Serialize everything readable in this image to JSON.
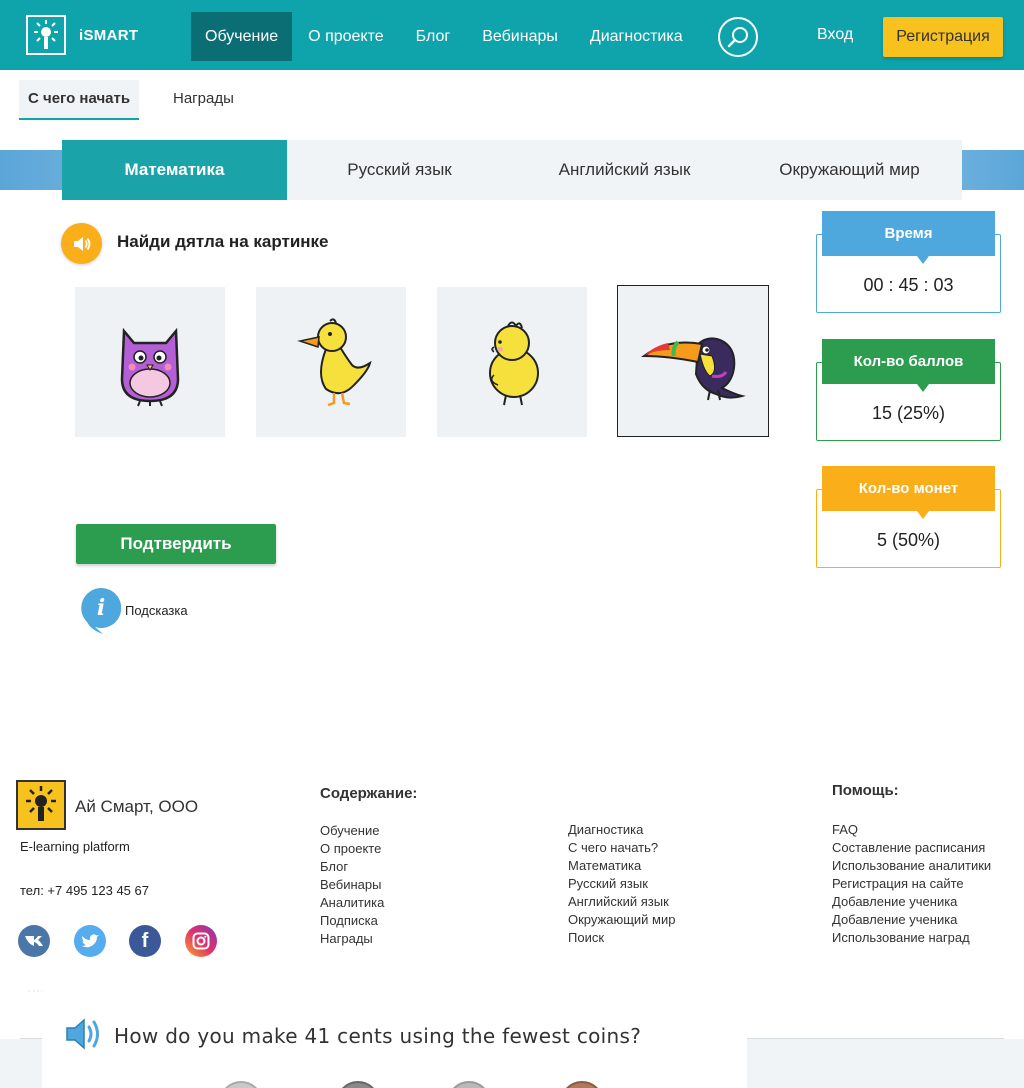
{
  "header": {
    "logo_text": "iSMART",
    "nav": [
      "Обучение",
      "О проекте",
      "Блог",
      "Вебинары",
      "Диагностика"
    ],
    "login": "Вход",
    "register": "Регистрация"
  },
  "subtabs": [
    "С чего начать",
    "Награды"
  ],
  "subjects": [
    "Математика",
    "Русский язык",
    "Английский язык",
    "Окружающий мир"
  ],
  "task": {
    "question": "Найди дятла на картинке",
    "options": [
      "owl-icon",
      "duck-icon",
      "chick-icon",
      "toucan-icon"
    ],
    "selected_index": 3,
    "confirm": "Подтвердить",
    "hint": "Подсказка"
  },
  "stats": {
    "time_label": "Время",
    "time_value": "00 : 45 : 03",
    "score_label": "Кол-во баллов",
    "score_value": "15 (25%)",
    "coins_label": "Кол-во монет",
    "coins_value": "5 (50%)",
    "colors": {
      "time": "#4ea7dd",
      "score": "#2c9c4f",
      "coins": "#f9ae1a"
    }
  },
  "footer": {
    "company": "Ай Смарт, ООО",
    "tagline": "E-learning platform",
    "phone": "тел: +7 495 123 45 67",
    "social": [
      "vk-icon",
      "twitter-icon",
      "facebook-icon",
      "instagram-icon"
    ],
    "contents_heading": "Содержание:",
    "contents_col1": [
      "Обучение",
      "О проекте",
      "Блог",
      "Вебинары",
      "Аналитика",
      "Подписка",
      "Награды"
    ],
    "contents_col2": [
      "Диагностика",
      "С чего начать?",
      "Математика",
      "Русский язык",
      "Английский язык",
      "Окружающий мир",
      "Поиск"
    ],
    "help_heading": "Помощь:",
    "help_items": [
      "FAQ",
      "Составление расписания",
      "Использование аналитики",
      "Регистрация на сайте",
      "Добавление ученика",
      "Добавление ученика",
      "Использование наград"
    ]
  },
  "overlay": {
    "question": "How do you make 41 cents using the fewest coins?"
  },
  "accent": "#0fa3ac"
}
